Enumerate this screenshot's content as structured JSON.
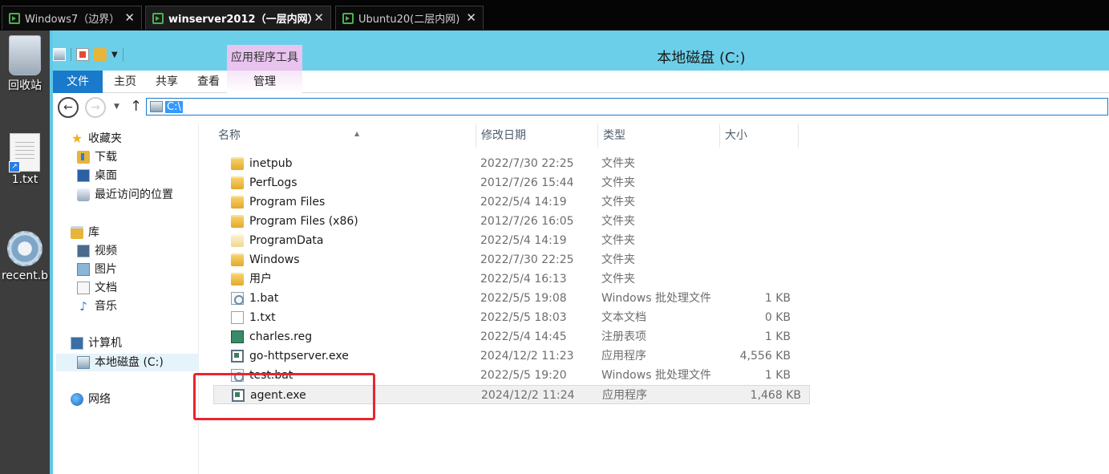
{
  "vm_tabs": [
    {
      "label": "Windows7（边界）",
      "close": "✕"
    },
    {
      "label": "winserver2012（一层内网）",
      "close": "✕"
    },
    {
      "label": "Ubuntu20(二层内网)",
      "close": "✕"
    }
  ],
  "desktop": {
    "items": [
      {
        "label": "回收站",
        "icon": "recycle-bin-icon"
      },
      {
        "label": "1.txt",
        "icon": "text-file-icon"
      },
      {
        "label": "recent.b",
        "icon": "gear-file-icon"
      }
    ]
  },
  "window": {
    "title": "本地磁盘 (C:)",
    "context_tab_header": "应用程序工具",
    "ribbon_tabs": [
      "文件",
      "主页",
      "共享",
      "查看",
      "管理"
    ],
    "address": "C:\\"
  },
  "nav_pane": {
    "favorites": {
      "label": "收藏夹",
      "items": [
        "下载",
        "桌面",
        "最近访问的位置"
      ]
    },
    "libraries": {
      "label": "库",
      "items": [
        "视频",
        "图片",
        "文档",
        "音乐"
      ]
    },
    "computer": {
      "label": "计算机",
      "items": [
        "本地磁盘 (C:)"
      ]
    },
    "network": {
      "label": "网络"
    }
  },
  "columns": {
    "name": "名称",
    "date": "修改日期",
    "type": "类型",
    "size": "大小"
  },
  "files": [
    {
      "name": "inetpub",
      "date": "2022/7/30 22:25",
      "type": "文件夹",
      "size": "",
      "icon": "folder"
    },
    {
      "name": "PerfLogs",
      "date": "2012/7/26 15:44",
      "type": "文件夹",
      "size": "",
      "icon": "folder"
    },
    {
      "name": "Program Files",
      "date": "2022/5/4 14:19",
      "type": "文件夹",
      "size": "",
      "icon": "folder"
    },
    {
      "name": "Program Files (x86)",
      "date": "2012/7/26 16:05",
      "type": "文件夹",
      "size": "",
      "icon": "folder"
    },
    {
      "name": "ProgramData",
      "date": "2022/5/4 14:19",
      "type": "文件夹",
      "size": "",
      "icon": "folder-pale"
    },
    {
      "name": "Windows",
      "date": "2022/7/30 22:25",
      "type": "文件夹",
      "size": "",
      "icon": "folder"
    },
    {
      "name": "用户",
      "date": "2022/5/4 16:13",
      "type": "文件夹",
      "size": "",
      "icon": "folder"
    },
    {
      "name": "1.bat",
      "date": "2022/5/5 19:08",
      "type": "Windows 批处理文件",
      "size": "1 KB",
      "icon": "bat"
    },
    {
      "name": "1.txt",
      "date": "2022/5/5 18:03",
      "type": "文本文档",
      "size": "0 KB",
      "icon": "txt"
    },
    {
      "name": "charles.reg",
      "date": "2022/5/4 14:45",
      "type": "注册表项",
      "size": "1 KB",
      "icon": "reg"
    },
    {
      "name": "go-httpserver.exe",
      "date": "2024/12/2 11:23",
      "type": "应用程序",
      "size": "4,556 KB",
      "icon": "exe"
    },
    {
      "name": "test.bat",
      "date": "2022/5/5 19:20",
      "type": "Windows 批处理文件",
      "size": "1 KB",
      "icon": "bat"
    },
    {
      "name": "agent.exe",
      "date": "2024/12/2 11:24",
      "type": "应用程序",
      "size": "1,468 KB",
      "icon": "exe"
    }
  ],
  "colors": {
    "accent": "#1979ca",
    "titlebar": "#6ccfe9",
    "highlight": "#e8262e",
    "context_tab": "#e8c4ef"
  }
}
